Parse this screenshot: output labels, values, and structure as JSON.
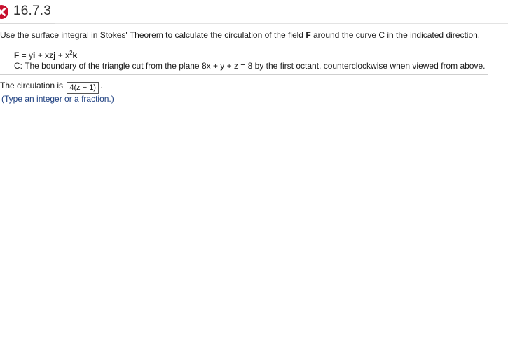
{
  "header": {
    "problem_number": "16.7.3",
    "status_icon": "x-mark-icon",
    "status_color": "#c8102e"
  },
  "question": {
    "instruction_pre": "Use the surface integral in Stokes' Theorem to calculate the circulation of the field ",
    "field_symbol": "F",
    "instruction_post": " around the curve C in the indicated direction.",
    "field_def": {
      "symbol": "F",
      "equals": " = y",
      "i": "i",
      "plus_xz": " + xz",
      "j": "j",
      "plus_x": " + x",
      "exponent": "2",
      "k": "k"
    },
    "curve_def": "C: The boundary of the triangle cut from the plane 8x + y + z = 8 by the first octant, counterclockwise when viewed from above."
  },
  "answer": {
    "prefix": "The circulation is ",
    "value": "4(z − 1)",
    "suffix": "."
  },
  "hint": "(Type an integer or a fraction.)"
}
